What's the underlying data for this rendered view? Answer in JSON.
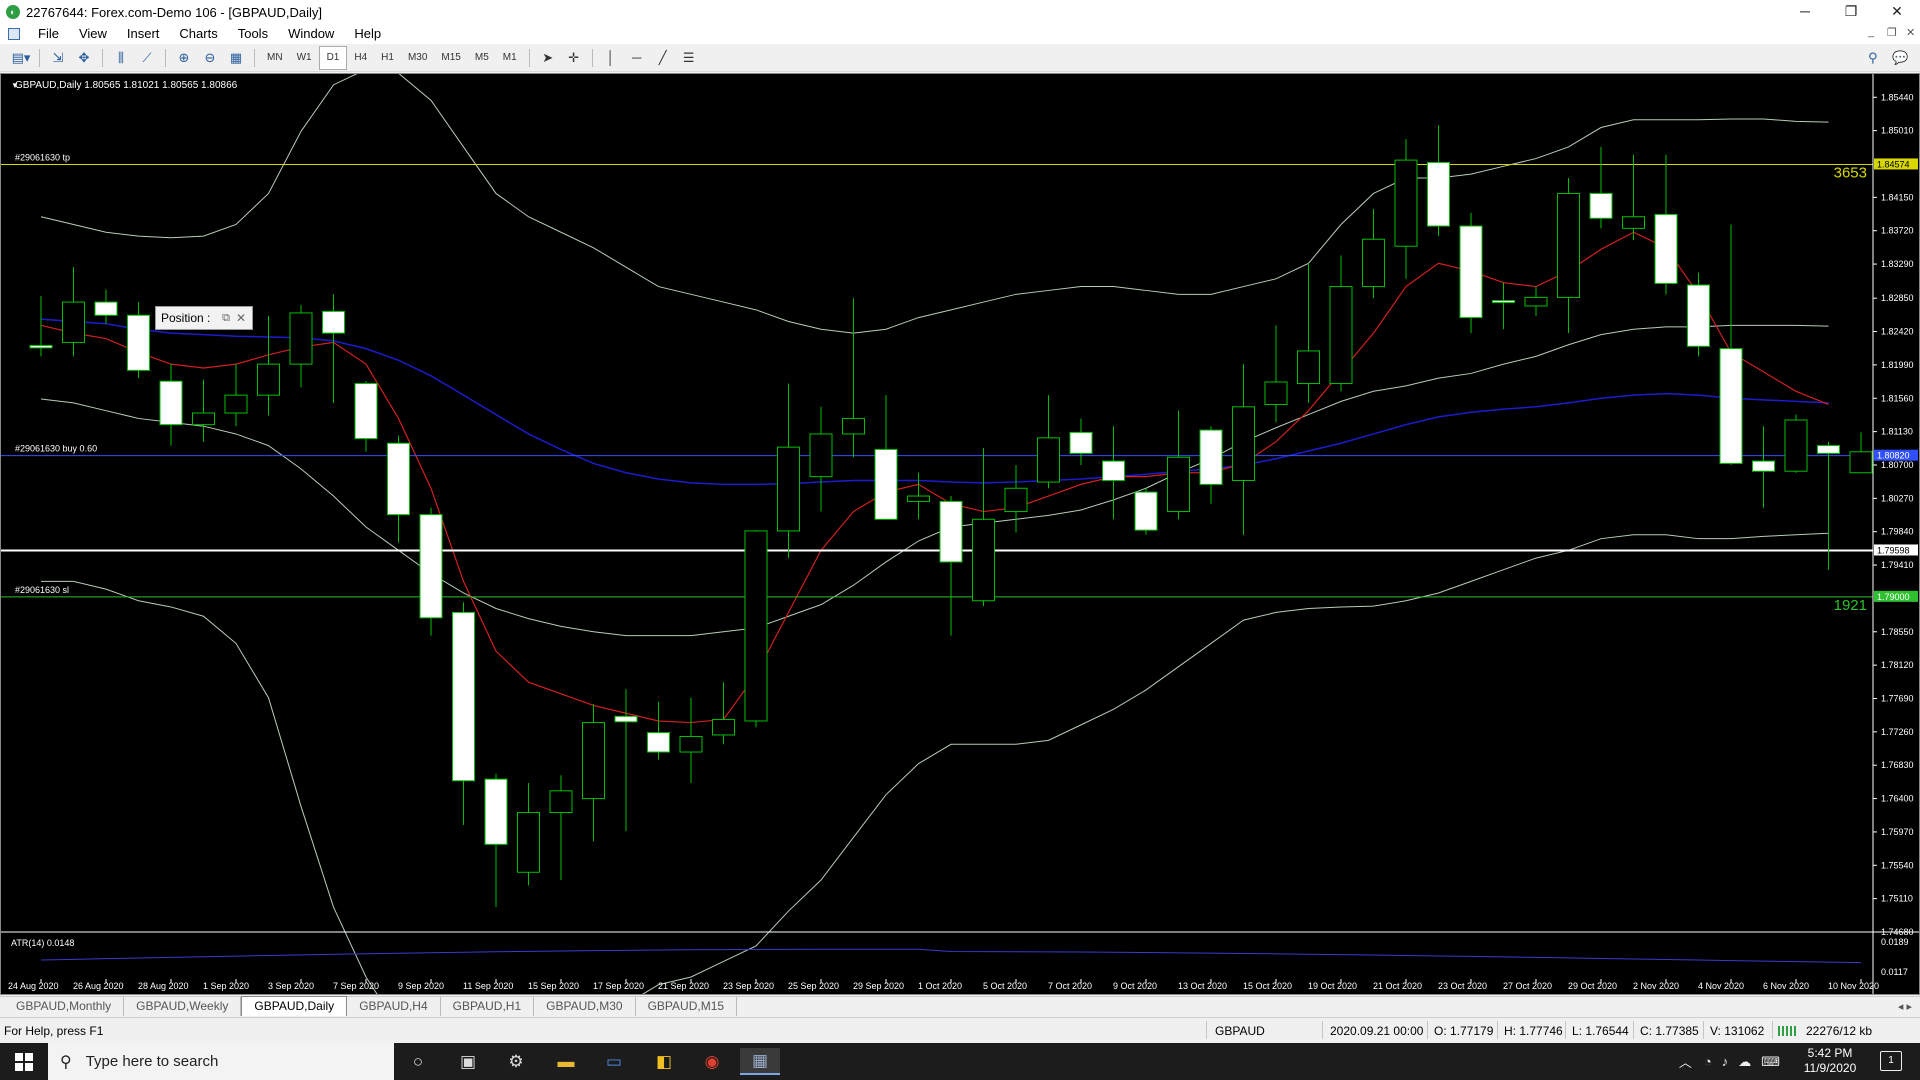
{
  "window": {
    "title": "22767644: Forex.com-Demo 106 - [GBPAUD,Daily]",
    "controls": [
      "─",
      "❐",
      "✕"
    ],
    "mdi_controls": [
      "_",
      "❐",
      "✕"
    ]
  },
  "menu": [
    "File",
    "View",
    "Insert",
    "Charts",
    "Tools",
    "Window",
    "Help"
  ],
  "toolbar": {
    "timeframes": [
      "MN",
      "W1",
      "D1",
      "H4",
      "H1",
      "M30",
      "M15",
      "M5",
      "M1"
    ],
    "active_timeframe": "D1"
  },
  "chart": {
    "header": "GBPAUD,Daily  1.80565 1.81021 1.80565 1.80866",
    "symbol": "GBPAUD",
    "timeframe": "Daily",
    "ohlc_header": {
      "open": 1.80565,
      "high": 1.81021,
      "low": 1.80565,
      "close": 1.80866
    },
    "position_panel_label": "Position :",
    "order_lines": [
      {
        "label": "#29061630 tp",
        "price": 1.84574,
        "price_label": "1.84574",
        "points_label": "3653",
        "color": "#d8d800"
      },
      {
        "label": "#29061630 buy 0.60",
        "price": 1.8082,
        "price_label": "1.80820",
        "color": "#3050ff"
      },
      {
        "label": "",
        "price": 1.79598,
        "price_label": "1.79598",
        "color": "#ffffff"
      },
      {
        "label": "#29061630 sl",
        "price": 1.79,
        "price_label": "1.79000",
        "points_label": "1921",
        "color": "#2ec02e"
      }
    ],
    "indicator_label": "ATR(14) 0.0148",
    "atr_axis": [
      "0.0189",
      "0.0117"
    ],
    "colors": {
      "bull_body": "#000000",
      "bear_body": "#ffffff",
      "wick": "#00c000",
      "ma_red": "#d02020",
      "ma_blue": "#1c1ccc",
      "bands": "#b8ccb8"
    }
  },
  "chart_data": {
    "type": "candlestick",
    "title": "GBPAUD,Daily",
    "y_axis_labels": [
      "1.85440",
      "1.85010",
      "1.84150",
      "1.83720",
      "1.83290",
      "1.82850",
      "1.82420",
      "1.81990",
      "1.81560",
      "1.81130",
      "1.80700",
      "1.80270",
      "1.79840",
      "1.79410",
      "1.78550",
      "1.78120",
      "1.77690",
      "1.77260",
      "1.76830",
      "1.76400",
      "1.75970",
      "1.75540",
      "1.75110",
      "1.74680"
    ],
    "ylim": [
      1.7468,
      1.8574
    ],
    "x_axis_labels": [
      "24 Aug 2020",
      "26 Aug 2020",
      "28 Aug 2020",
      "1 Sep 2020",
      "3 Sep 2020",
      "7 Sep 2020",
      "9 Sep 2020",
      "11 Sep 2020",
      "15 Sep 2020",
      "17 Sep 2020",
      "21 Sep 2020",
      "23 Sep 2020",
      "25 Sep 2020",
      "29 Sep 2020",
      "1 Oct 2020",
      "5 Oct 2020",
      "7 Oct 2020",
      "9 Oct 2020",
      "13 Oct 2020",
      "15 Oct 2020",
      "19 Oct 2020",
      "21 Oct 2020",
      "23 Oct 2020",
      "27 Oct 2020",
      "29 Oct 2020",
      "2 Nov 2020",
      "4 Nov 2020",
      "6 Nov 2020",
      "10 Nov 2020"
    ],
    "candles": [
      [
        1.8224,
        1.8221,
        1.8288,
        1.821
      ],
      [
        1.8228,
        1.828,
        1.8325,
        1.821
      ],
      [
        1.828,
        1.8263,
        1.8296,
        1.8252
      ],
      [
        1.8263,
        1.8192,
        1.828,
        1.8182
      ],
      [
        1.8178,
        1.8122,
        1.82,
        1.8095
      ],
      [
        1.8122,
        1.8137,
        1.818,
        1.81
      ],
      [
        1.8137,
        1.816,
        1.82,
        1.812
      ],
      [
        1.816,
        1.82,
        1.8262,
        1.8134
      ],
      [
        1.82,
        1.8266,
        1.8276,
        1.817
      ],
      [
        1.8268,
        1.824,
        1.829,
        1.815
      ],
      [
        1.8175,
        1.8104,
        1.8178,
        1.8087
      ],
      [
        1.8098,
        1.8006,
        1.8108,
        1.797
      ],
      [
        1.8006,
        1.7873,
        1.8015,
        1.785
      ],
      [
        1.788,
        1.7663,
        1.7893,
        1.7606
      ],
      [
        1.7665,
        1.7581,
        1.7672,
        1.75
      ],
      [
        1.7545,
        1.7622,
        1.766,
        1.7528
      ],
      [
        1.7622,
        1.765,
        1.767,
        1.7535
      ],
      [
        1.764,
        1.7738,
        1.7762,
        1.7585
      ],
      [
        1.7746,
        1.7739,
        1.7781,
        1.7598
      ],
      [
        1.7725,
        1.77,
        1.7765,
        1.769
      ],
      [
        1.77,
        1.772,
        1.777,
        1.766
      ],
      [
        1.7722,
        1.7742,
        1.779,
        1.771
      ],
      [
        1.774,
        1.7985,
        1.7986,
        1.7732
      ],
      [
        1.7985,
        1.8093,
        1.8175,
        1.795
      ],
      [
        1.8055,
        1.811,
        1.8145,
        1.801
      ],
      [
        1.811,
        1.813,
        1.8285,
        1.808
      ],
      [
        1.809,
        1.8,
        1.816,
        1.8005
      ],
      [
        1.8023,
        1.803,
        1.806,
        1.8
      ],
      [
        1.8023,
        1.7945,
        1.803,
        1.785
      ],
      [
        1.7895,
        1.8,
        1.8092,
        1.7888
      ],
      [
        1.801,
        1.804,
        1.807,
        1.7983
      ],
      [
        1.8048,
        1.8105,
        1.816,
        1.804
      ],
      [
        1.8112,
        1.8085,
        1.813,
        1.807
      ],
      [
        1.8075,
        1.805,
        1.812,
        1.8
      ],
      [
        1.8035,
        1.7986,
        1.804,
        1.798
      ],
      [
        1.801,
        1.808,
        1.814,
        1.8
      ],
      [
        1.8115,
        1.8045,
        1.812,
        1.802
      ],
      [
        1.805,
        1.8145,
        1.82,
        1.798
      ],
      [
        1.8148,
        1.8177,
        1.825,
        1.8125
      ],
      [
        1.8175,
        1.8217,
        1.833,
        1.815
      ],
      [
        1.8175,
        1.83,
        1.834,
        1.8165
      ],
      [
        1.83,
        1.8361,
        1.84,
        1.8285
      ],
      [
        1.8352,
        1.8463,
        1.849,
        1.831
      ],
      [
        1.846,
        1.8378,
        1.8508,
        1.8365
      ],
      [
        1.8378,
        1.826,
        1.8395,
        1.824
      ],
      [
        1.8282,
        1.828,
        1.8305,
        1.8245
      ],
      [
        1.8275,
        1.8286,
        1.83,
        1.8262
      ],
      [
        1.8286,
        1.842,
        1.844,
        1.824
      ],
      [
        1.842,
        1.8388,
        1.848,
        1.8375
      ],
      [
        1.8375,
        1.839,
        1.847,
        1.836
      ],
      [
        1.8393,
        1.8304,
        1.847,
        1.829
      ],
      [
        1.8302,
        1.8223,
        1.8318,
        1.821
      ],
      [
        1.822,
        1.8072,
        1.838,
        1.807
      ],
      [
        1.8075,
        1.8062,
        1.812,
        1.8015
      ],
      [
        1.8062,
        1.8128,
        1.8135,
        1.806
      ],
      [
        1.8095,
        1.8085,
        1.81,
        1.7935
      ],
      [
        1.806,
        1.8087,
        1.8112,
        1.806
      ]
    ],
    "ma_red": [
      1.825,
      1.824,
      1.8233,
      1.8215,
      1.82,
      1.8195,
      1.82,
      1.8212,
      1.8222,
      1.8228,
      1.82,
      1.813,
      1.804,
      1.792,
      1.783,
      1.779,
      1.7775,
      1.776,
      1.775,
      1.774,
      1.7738,
      1.7742,
      1.78,
      1.788,
      1.796,
      1.801,
      1.8035,
      1.8045,
      1.802,
      1.801,
      1.8015,
      1.803,
      1.8045,
      1.8055,
      1.8055,
      1.806,
      1.806,
      1.8072,
      1.81,
      1.814,
      1.819,
      1.824,
      1.83,
      1.833,
      1.832,
      1.8305,
      1.83,
      1.832,
      1.8348,
      1.837,
      1.835,
      1.829,
      1.8215,
      1.819,
      1.8165,
      1.8148
    ],
    "ma_blue": [
      1.8258,
      1.8255,
      1.8252,
      1.8245,
      1.824,
      1.8238,
      1.8236,
      1.8235,
      1.8234,
      1.823,
      1.822,
      1.8205,
      1.8185,
      1.816,
      1.8135,
      1.811,
      1.809,
      1.8072,
      1.806,
      1.8052,
      1.8047,
      1.8045,
      1.8045,
      1.8046,
      1.8048,
      1.805,
      1.805,
      1.805,
      1.8048,
      1.8047,
      1.8048,
      1.805,
      1.8052,
      1.8055,
      1.8058,
      1.8062,
      1.8065,
      1.807,
      1.8078,
      1.8088,
      1.8098,
      1.811,
      1.8122,
      1.8132,
      1.8138,
      1.8142,
      1.8145,
      1.815,
      1.8156,
      1.816,
      1.8162,
      1.816,
      1.8156,
      1.8154,
      1.8152,
      1.815
    ],
    "bb_upper": [
      1.839,
      1.838,
      1.837,
      1.8365,
      1.8363,
      1.8365,
      1.838,
      1.842,
      1.85,
      1.856,
      1.858,
      1.8575,
      1.854,
      1.848,
      1.842,
      1.839,
      1.837,
      1.835,
      1.8325,
      1.83,
      1.829,
      1.828,
      1.827,
      1.8255,
      1.8245,
      1.824,
      1.8245,
      1.826,
      1.827,
      1.828,
      1.829,
      1.8295,
      1.83,
      1.83,
      1.8295,
      1.829,
      1.829,
      1.83,
      1.831,
      1.833,
      1.838,
      1.842,
      1.844,
      1.844,
      1.8445,
      1.8455,
      1.8465,
      1.848,
      1.8505,
      1.8515,
      1.8515,
      1.8515,
      1.8516,
      1.8516,
      1.8513,
      1.8512
    ],
    "bb_mid": [
      1.8155,
      1.815,
      1.814,
      1.813,
      1.8125,
      1.812,
      1.811,
      1.8095,
      1.8065,
      1.803,
      1.799,
      1.796,
      1.793,
      1.7905,
      1.7885,
      1.7872,
      1.7862,
      1.7855,
      1.785,
      1.785,
      1.785,
      1.7855,
      1.786,
      1.7875,
      1.789,
      1.7915,
      1.7945,
      1.7972,
      1.799,
      1.7995,
      1.8,
      1.8005,
      1.8012,
      1.8025,
      1.804,
      1.806,
      1.8078,
      1.81,
      1.8118,
      1.8135,
      1.8152,
      1.8165,
      1.8172,
      1.8182,
      1.8188,
      1.82,
      1.821,
      1.8225,
      1.8238,
      1.8245,
      1.8248,
      1.8248,
      1.825,
      1.825,
      1.825,
      1.8249
    ],
    "bb_lower": [
      1.792,
      1.792,
      1.791,
      1.7895,
      1.7887,
      1.7875,
      1.784,
      1.777,
      1.763,
      1.75,
      1.741,
      1.7345,
      1.732,
      1.733,
      1.735,
      1.7355,
      1.735,
      1.7356,
      1.7375,
      1.74,
      1.741,
      1.743,
      1.745,
      1.7495,
      1.7535,
      1.759,
      1.7645,
      1.7685,
      1.771,
      1.771,
      1.771,
      1.7715,
      1.7735,
      1.7755,
      1.778,
      1.781,
      1.784,
      1.787,
      1.788,
      1.7885,
      1.7887,
      1.7888,
      1.7895,
      1.7905,
      1.792,
      1.7935,
      1.795,
      1.796,
      1.7975,
      1.798,
      1.798,
      1.7975,
      1.7975,
      1.7978,
      1.798,
      1.7982
    ]
  },
  "tabs": [
    "GBPAUD,Monthly",
    "GBPAUD,Weekly",
    "GBPAUD,Daily",
    "GBPAUD,H4",
    "GBPAUD,H1",
    "GBPAUD,M30",
    "GBPAUD,M15"
  ],
  "active_tab": "GBPAUD,Daily",
  "status": {
    "help": "For Help, press F1",
    "symbol": "GBPAUD",
    "datetime": "2020.09.21 00:00",
    "open": "O: 1.77179",
    "high": "H: 1.77746",
    "low": "L: 1.76544",
    "close": "C: 1.77385",
    "volume": "V: 131062",
    "traffic": "22276/12 kb"
  },
  "taskbar": {
    "search_placeholder": "Type here to search",
    "time": "5:42 PM",
    "date": "11/9/2020",
    "notifications": "1"
  }
}
